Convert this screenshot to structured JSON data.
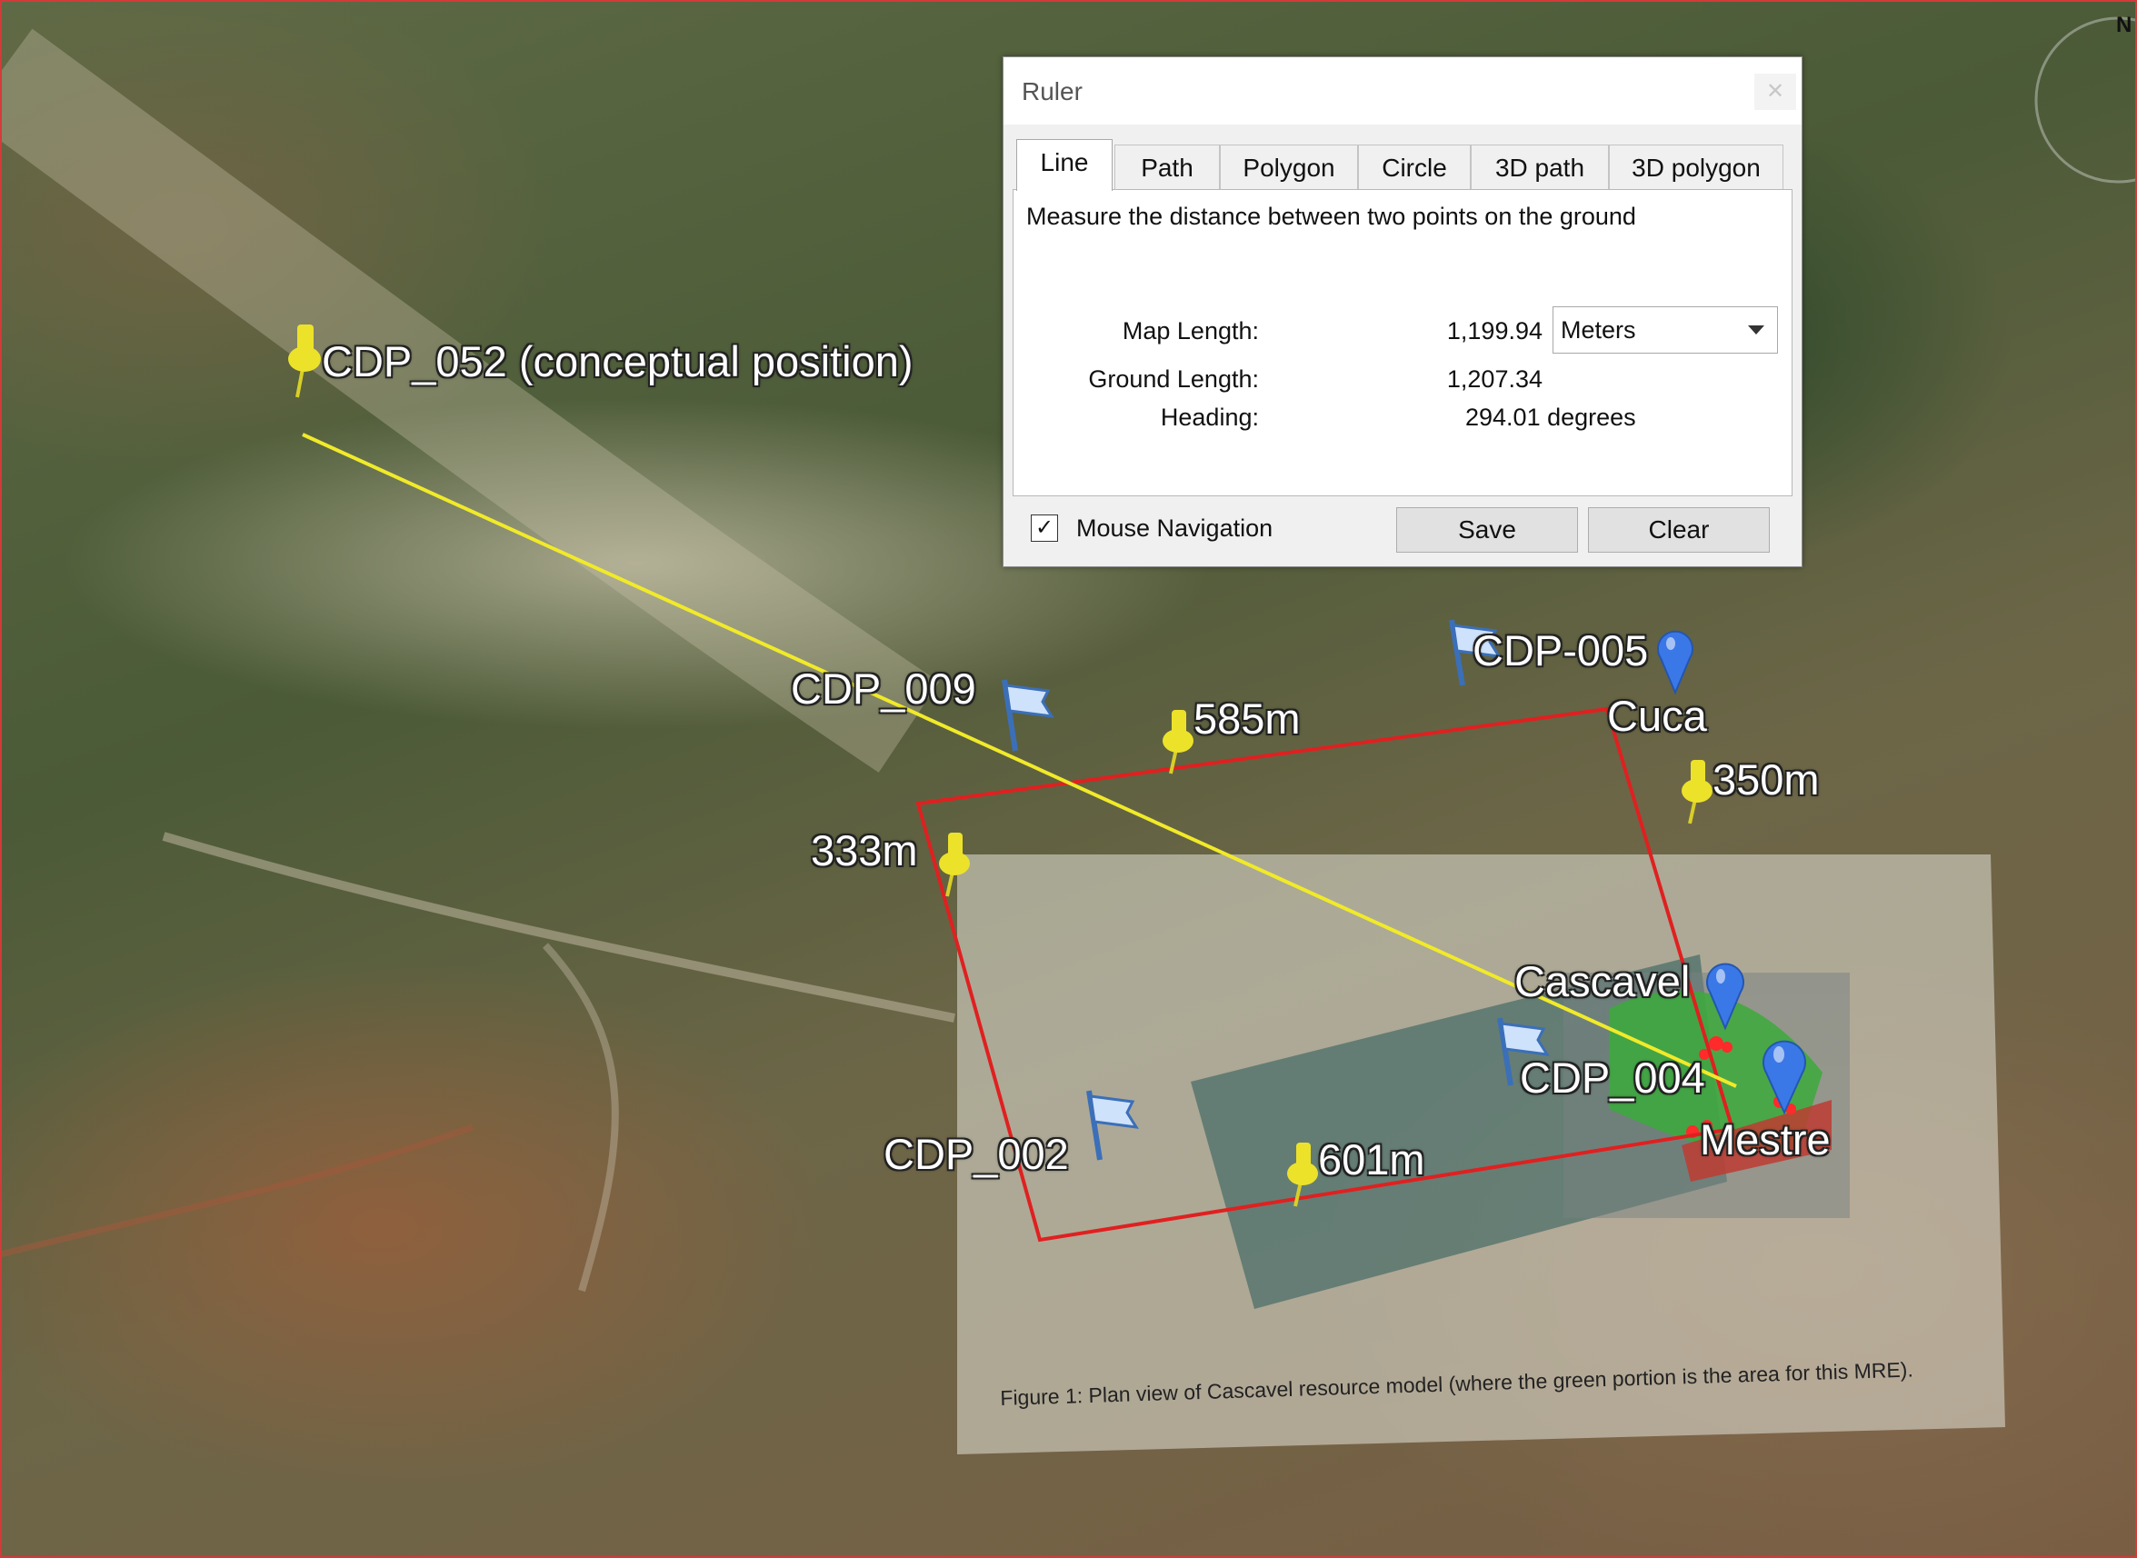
{
  "colors": {
    "measure_line": "#f1ea2a",
    "boundary": "#e02020",
    "pin": "#ede22a",
    "flag": "#6b9fe0",
    "balloon": "#3b78e7"
  },
  "map": {
    "labels": [
      {
        "id": "cdp-052",
        "text": "CDP_052 (conceptual position)",
        "icon": "yellow-pushpin-icon"
      },
      {
        "id": "cdp-009",
        "text": "CDP_009",
        "icon": "blue-flag-icon"
      },
      {
        "id": "cdp-005",
        "text": "CDP-005",
        "icon": "blue-flag-icon"
      },
      {
        "id": "cuca",
        "text": "Cuca",
        "icon": "blue-balloon-icon"
      },
      {
        "id": "elev-585",
        "text": "585m",
        "icon": "yellow-pushpin-icon"
      },
      {
        "id": "elev-350",
        "text": "350m",
        "icon": "yellow-pushpin-icon"
      },
      {
        "id": "elev-333",
        "text": "333m",
        "icon": "yellow-pushpin-icon"
      },
      {
        "id": "cascavel",
        "text": "Cascavel",
        "icon": "blue-balloon-icon"
      },
      {
        "id": "cdp-004",
        "text": "CDP_004",
        "icon": "blue-flag-icon"
      },
      {
        "id": "mestre",
        "text": "Mestre",
        "icon": "blue-balloon-icon"
      },
      {
        "id": "cdp-002",
        "text": "CDP_002",
        "icon": "blue-flag-icon"
      },
      {
        "id": "elev-601",
        "text": "601m",
        "icon": "yellow-pushpin-icon"
      }
    ],
    "figure_caption": "Figure 1: Plan view of Cascavel resource model (where the green portion is the area for this MRE).",
    "compass_letter": "N"
  },
  "ruler": {
    "title": "Ruler",
    "tabs": [
      "Line",
      "Path",
      "Polygon",
      "Circle",
      "3D path",
      "3D polygon"
    ],
    "active_tab": "Line",
    "description": "Measure the distance between two points on the ground",
    "map_length_label": "Map Length:",
    "map_length_value": "1,199.94",
    "unit": "Meters",
    "ground_length_label": "Ground Length:",
    "ground_length_value": "1,207.34",
    "heading_label": "Heading:",
    "heading_value": "294.01 degrees",
    "mouse_navigation_label": "Mouse Navigation",
    "mouse_navigation_checked": true,
    "save_label": "Save",
    "clear_label": "Clear"
  }
}
